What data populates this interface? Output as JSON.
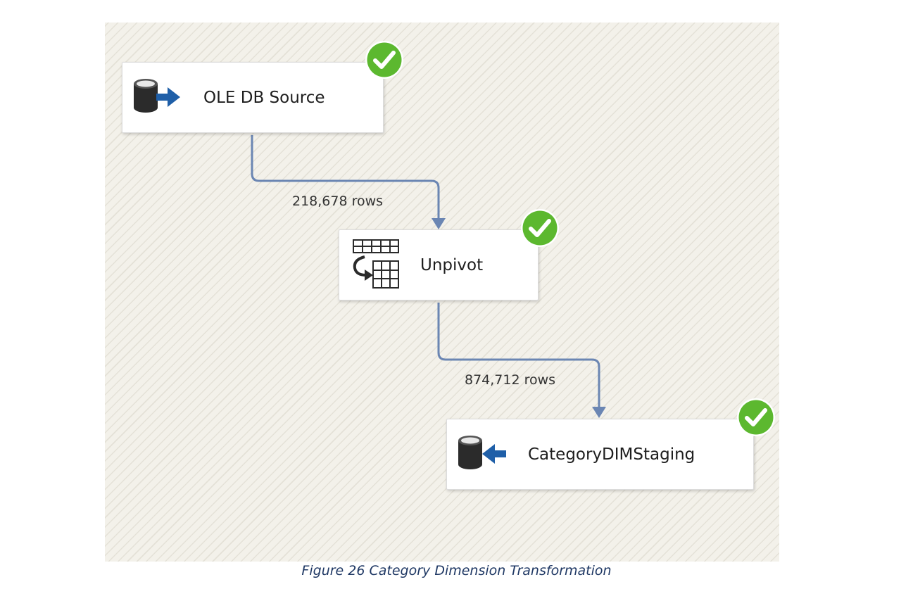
{
  "diagram": {
    "nodes": [
      {
        "id": "source",
        "label": "OLE DB Source",
        "icon": "database-source-icon",
        "status": "success"
      },
      {
        "id": "unpivot",
        "label": "Unpivot",
        "icon": "unpivot-icon",
        "status": "success"
      },
      {
        "id": "destination",
        "label": "CategoryDIMStaging",
        "icon": "database-destination-icon",
        "status": "success"
      }
    ],
    "edges": [
      {
        "from": "source",
        "to": "unpivot",
        "label": "218,678 rows"
      },
      {
        "from": "unpivot",
        "to": "destination",
        "label": "874,712 rows"
      }
    ]
  },
  "caption": "Figure 26 Category Dimension Transformation",
  "colors": {
    "connector": "#6b86b3",
    "status_green": "#5cb82f",
    "arrow_blue": "#1f5fa8",
    "caption": "#1f3864"
  }
}
